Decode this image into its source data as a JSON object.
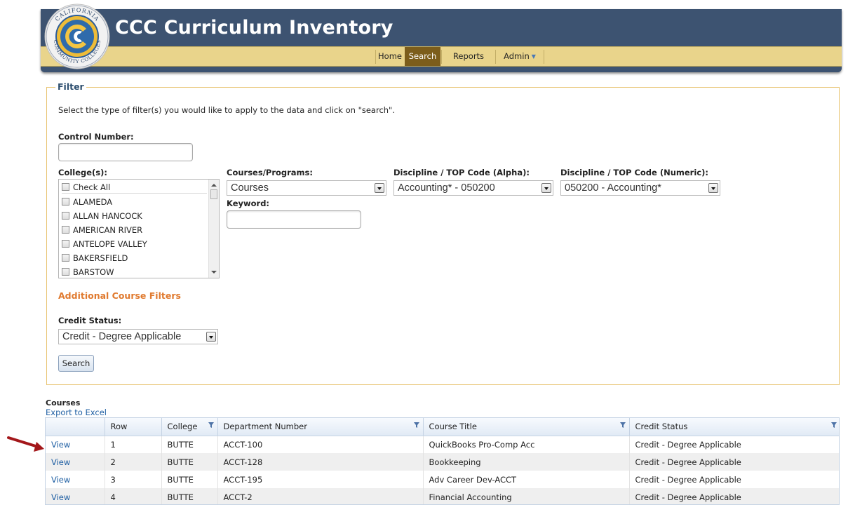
{
  "app": {
    "title": "CCC Curriculum Inventory",
    "logo_text": "CALIFORNIA COMMUNITY COLLEGES"
  },
  "nav": {
    "items": [
      {
        "label": "Home",
        "active": false
      },
      {
        "label": "Search",
        "active": true
      },
      {
        "label": "Reports",
        "active": false
      },
      {
        "label": "Admin",
        "active": false,
        "has_dropdown": true
      }
    ]
  },
  "filter": {
    "legend": "Filter",
    "instructions": "Select the type of filter(s) you would like to apply to the data and click on \"search\".",
    "control_number": {
      "label": "Control Number:",
      "value": ""
    },
    "colleges": {
      "label": "College(s):",
      "items": [
        "Check All",
        "ALAMEDA",
        "ALLAN HANCOCK",
        "AMERICAN RIVER",
        "ANTELOPE VALLEY",
        "BAKERSFIELD",
        "BARSTOW"
      ]
    },
    "courses_programs": {
      "label": "Courses/Programs:",
      "value": "Courses"
    },
    "keyword": {
      "label": "Keyword:",
      "value": ""
    },
    "discipline_alpha": {
      "label": "Discipline / TOP Code (Alpha):",
      "value": "Accounting* - 050200"
    },
    "discipline_numeric": {
      "label": "Discipline / TOP Code (Numeric):",
      "value": "050200 - Accounting*"
    },
    "additional_filters_label": "Additional Course Filters",
    "credit_status": {
      "label": "Credit Status:",
      "value": "Credit - Degree Applicable"
    },
    "search_button": "Search"
  },
  "courses": {
    "title": "Courses",
    "export_label": "Export to Excel",
    "columns": [
      "",
      "Row",
      "College",
      "Department Number",
      "Course Title",
      "Credit Status"
    ],
    "rows": [
      {
        "action": "View",
        "row": "1",
        "college": "BUTTE",
        "dept": "ACCT-100",
        "title": "QuickBooks Pro-Comp Acc",
        "credit": "Credit - Degree Applicable"
      },
      {
        "action": "View",
        "row": "2",
        "college": "BUTTE",
        "dept": "ACCT-128",
        "title": "Bookkeeping",
        "credit": "Credit - Degree Applicable"
      },
      {
        "action": "View",
        "row": "3",
        "college": "BUTTE",
        "dept": "ACCT-195",
        "title": "Adv Career Dev-ACCT",
        "credit": "Credit - Degree Applicable"
      },
      {
        "action": "View",
        "row": "4",
        "college": "BUTTE",
        "dept": "ACCT-2",
        "title": "Financial Accounting",
        "credit": "Credit - Degree Applicable"
      }
    ]
  },
  "colors": {
    "header_bg": "#3d5371",
    "nav_bg": "#e9d48b",
    "nav_active": "#7c5d1b",
    "accent_orange": "#e07a2f",
    "link_blue": "#1f5fa3",
    "annotation_arrow": "#a3171a"
  }
}
